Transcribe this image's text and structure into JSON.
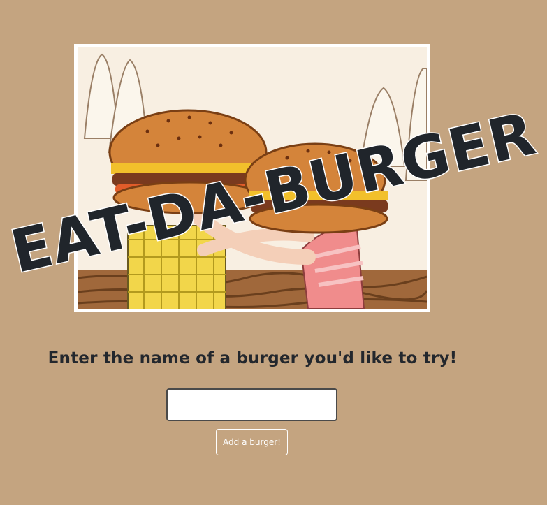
{
  "header": {
    "title": "EAT-DA-BURGER"
  },
  "hero": {
    "image_name": "couple-eating-burgers-illustration"
  },
  "form": {
    "prompt": "Enter the name of a burger you'd like to try!",
    "input_value": "",
    "input_placeholder": "",
    "submit_label": "Add a burger!"
  },
  "colors": {
    "background": "#c4a480",
    "title_text": "#20252b",
    "button_border": "#ffffff"
  }
}
